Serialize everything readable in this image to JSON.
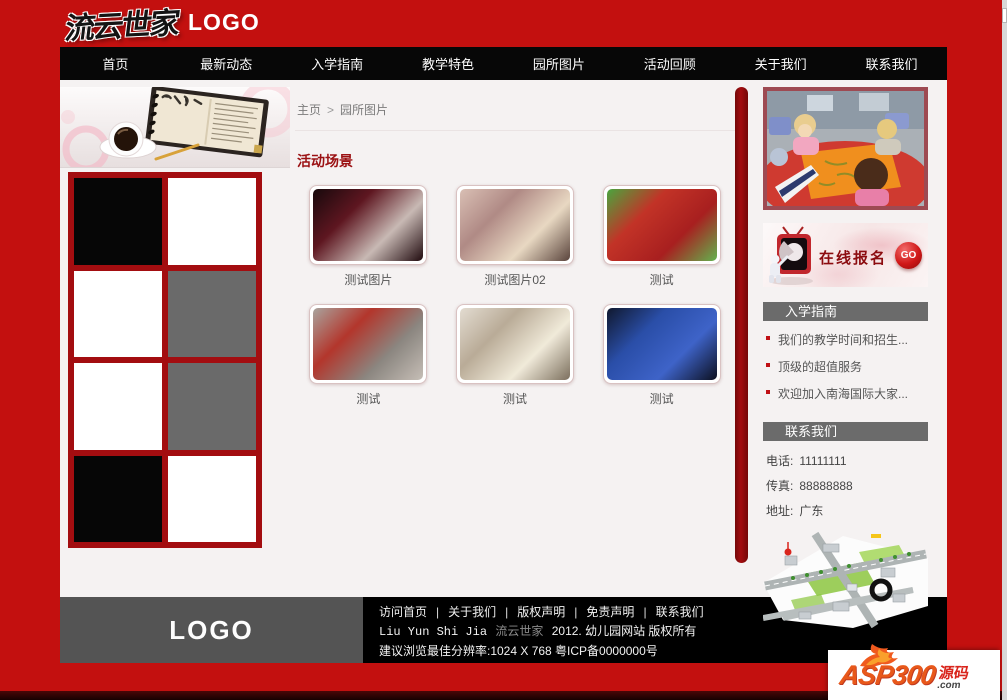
{
  "header": {
    "brand_calligraphy": "流云世家",
    "logo_text": "LOGO"
  },
  "nav": {
    "items": [
      "首页",
      "最新动态",
      "入学指南",
      "教学特色",
      "园所图片",
      "活动回顾",
      "关于我们",
      "联系我们"
    ]
  },
  "main": {
    "breadcrumb": {
      "home": "主页",
      "separator": ">",
      "current": "园所图片"
    },
    "section_title": "活动场景",
    "photos": [
      {
        "caption": "测试图片",
        "tones": [
          "#17090c",
          "#5e1620",
          "#c8b9b4",
          "#200a0e"
        ]
      },
      {
        "caption": "测试图片02",
        "tones": [
          "#d9bfb4",
          "#b08a85",
          "#e8d8c2",
          "#5a443c"
        ]
      },
      {
        "caption": "测试",
        "tones": [
          "#4aa53e",
          "#c23327",
          "#a81f1f",
          "#63b24e"
        ]
      },
      {
        "caption": "测试",
        "tones": [
          "#a9a49e",
          "#b3362c",
          "#8b8680",
          "#c6beb6"
        ]
      },
      {
        "caption": "测试",
        "tones": [
          "#e3dcd1",
          "#b9ab97",
          "#f0ead9",
          "#7c6f5e"
        ]
      },
      {
        "caption": "测试",
        "tones": [
          "#10182e",
          "#2a4ea8",
          "#3e63c8",
          "#0c1020"
        ]
      }
    ]
  },
  "left_panel": {
    "checker_cells": [
      "#060606",
      "#ffffff",
      "#ffffff",
      "#6a6a6a",
      "#ffffff",
      "#6a6a6a",
      "#060606",
      "#ffffff"
    ]
  },
  "sidebar": {
    "signup": {
      "label": "在线报名",
      "go_label": "GO"
    },
    "guide": {
      "title": "入学指南",
      "links": [
        "我们的教学时间和招生...",
        "顶级的超值服务",
        "欢迎加入南海国际大家..."
      ]
    },
    "contact": {
      "title": "联系我们",
      "rows": [
        {
          "label": "电话:",
          "value": "11111111"
        },
        {
          "label": "传真:",
          "value": "88888888"
        },
        {
          "label": "地址:",
          "value": "广东"
        }
      ]
    }
  },
  "footer": {
    "logo_text": "LOGO",
    "links": [
      "访问首页",
      "关于我们",
      "版权声明",
      "免责声明",
      "联系我们"
    ],
    "copyright_en": "Liu Yun Shi Jia",
    "copyright_brand": "流云世家",
    "copyright_rest": "2012.  幼儿园网站  版权所有",
    "resolution_line": "建议浏览最佳分辨率:1024 X 768  粤ICP备0000000号"
  },
  "watermark": {
    "brand": "ASP300",
    "tag": "源码",
    "domain": ".com"
  }
}
